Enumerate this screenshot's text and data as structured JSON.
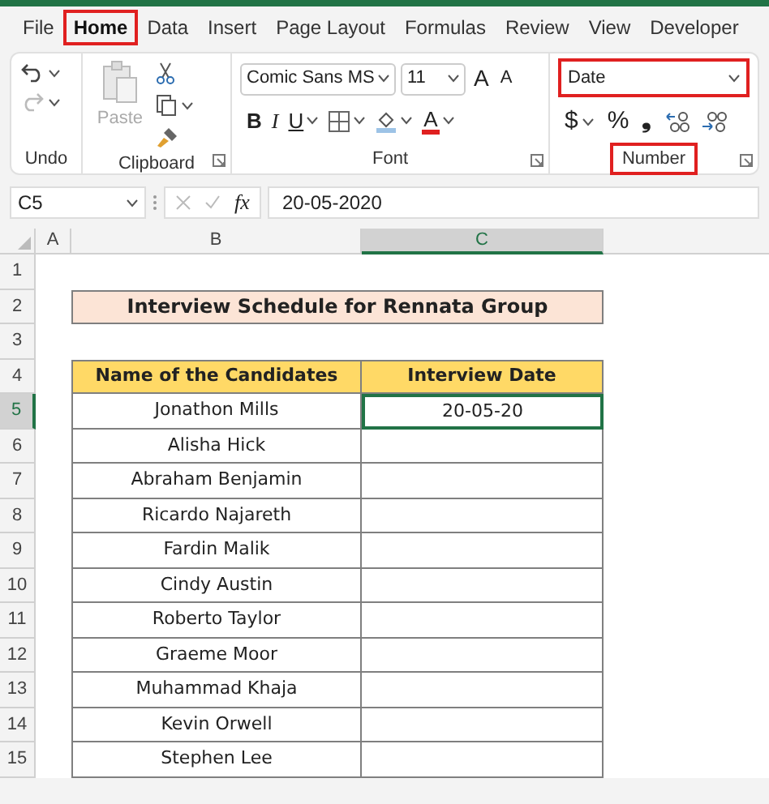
{
  "tabs": [
    {
      "label": "File",
      "selected": false,
      "highlighted": false
    },
    {
      "label": "Home",
      "selected": true,
      "highlighted": true
    },
    {
      "label": "Data",
      "selected": false,
      "highlighted": false
    },
    {
      "label": "Insert",
      "selected": false,
      "highlighted": false
    },
    {
      "label": "Page Layout",
      "selected": false,
      "highlighted": false
    },
    {
      "label": "Formulas",
      "selected": false,
      "highlighted": false
    },
    {
      "label": "Review",
      "selected": false,
      "highlighted": false
    },
    {
      "label": "View",
      "selected": false,
      "highlighted": false
    },
    {
      "label": "Developer",
      "selected": false,
      "highlighted": false
    }
  ],
  "ribbon": {
    "undo": {
      "group": "Undo"
    },
    "clipboard": {
      "paste_label": "Paste",
      "paste_disabled": true,
      "group": "Clipboard"
    },
    "font": {
      "name": "Comic Sans MS",
      "size": "11",
      "grow": "A",
      "shrink": "A",
      "bold": "B",
      "italic": "I",
      "underline": "U",
      "font_color": "A",
      "group": "Font"
    },
    "number": {
      "format": "Date",
      "format_highlighted": true,
      "currency": "$",
      "percent": "%",
      "comma": "❟",
      "group": "Number",
      "group_highlighted": true
    }
  },
  "formula_bar": {
    "name_box": "C5",
    "fx": "fx",
    "value": "20-05-2020"
  },
  "sheet": {
    "columns": [
      {
        "label": "A",
        "selected": false
      },
      {
        "label": "B",
        "selected": false
      },
      {
        "label": "C",
        "selected": true
      }
    ],
    "rows": [
      {
        "label": "1",
        "selected": false
      },
      {
        "label": "2",
        "selected": false
      },
      {
        "label": "3",
        "selected": false
      },
      {
        "label": "4",
        "selected": false
      },
      {
        "label": "5",
        "selected": true
      },
      {
        "label": "6",
        "selected": false
      },
      {
        "label": "7",
        "selected": false
      },
      {
        "label": "8",
        "selected": false
      },
      {
        "label": "9",
        "selected": false
      },
      {
        "label": "10",
        "selected": false
      },
      {
        "label": "11",
        "selected": false
      },
      {
        "label": "12",
        "selected": false
      },
      {
        "label": "13",
        "selected": false
      },
      {
        "label": "14",
        "selected": false
      },
      {
        "label": "15",
        "selected": false
      }
    ],
    "title": "Interview Schedule for Rennata Group",
    "headers": [
      "Name of the Candidates",
      "Interview Date"
    ],
    "entries": [
      {
        "name": "Jonathon Mills",
        "date": "20-05-20",
        "selected": true
      },
      {
        "name": "Alisha Hick",
        "selected": false
      },
      {
        "name": "Abraham Benjamin",
        "selected": false
      },
      {
        "name": "Ricardo Najareth",
        "selected": false
      },
      {
        "name": "Fardin Malik",
        "selected": false
      },
      {
        "name": "Cindy Austin",
        "selected": false
      },
      {
        "name": "Roberto Taylor",
        "selected": false
      },
      {
        "name": "Graeme Moor",
        "selected": false
      },
      {
        "name": "Muhammad Khaja",
        "selected": false
      },
      {
        "name": "Kevin Orwell",
        "selected": false
      },
      {
        "name": "Stephen Lee",
        "selected": false
      }
    ]
  }
}
